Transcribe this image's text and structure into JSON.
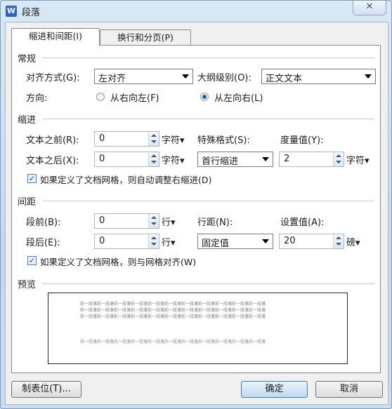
{
  "window": {
    "title": "段落",
    "close_symbol": "✕",
    "app_icon_letter": "W"
  },
  "tabs": [
    {
      "label": "缩进和间距(I)",
      "active": true
    },
    {
      "label": "换行和分页(P)",
      "active": false
    }
  ],
  "general": {
    "title": "常规",
    "alignment_label": "对齐方式(G):",
    "alignment_value": "左对齐",
    "outline_label": "大纲级别(O):",
    "outline_value": "正文文本",
    "direction_label": "方向:",
    "rtl_label": "从右向左(F)",
    "ltr_label": "从左向右(L)",
    "direction_selected": "ltr"
  },
  "indent": {
    "title": "缩进",
    "before_label": "文本之前(R):",
    "before_value": "0",
    "before_unit": "字符▾",
    "after_label": "文本之后(X):",
    "after_value": "0",
    "after_unit": "字符▾",
    "special_label": "特殊格式(S):",
    "special_value": "首行缩进",
    "measure_label": "度量值(Y):",
    "measure_value": "2",
    "measure_unit": "字符▾",
    "grid_check_label": "如果定义了文档网格，则自动调整右缩进(D)",
    "grid_checked": true
  },
  "spacing": {
    "title": "间距",
    "before_label": "段前(B):",
    "before_value": "0",
    "before_unit": "行▾",
    "after_label": "段后(E):",
    "after_value": "0",
    "after_unit": "行▾",
    "line_label": "行距(N):",
    "line_value": "固定值",
    "setting_label": "设置值(A):",
    "setting_value": "20",
    "setting_unit": "磅▾",
    "grid_check_label": "如果定义了文档网格，则与网格对齐(W)",
    "grid_checked": true
  },
  "preview": {
    "title": "预览",
    "prev_lines": [
      "前一段落前一段落前一段落前一段落前一段落前一段落前一段落前一段落前一段落前一段落前一段落",
      "前一段落前一段落前一段落前一段落前一段落前一段落前一段落前一段落前一段落前一段落前一段落",
      "前一段落前一段落前一段落前一段落前一段落前一段落前一段落前一段落前一段落前一段落前一段落"
    ],
    "next_line": "后一段落后一段落后一段落后一段落后一段落后一段落后一段落后一段落后一段落后一段落后一段落"
  },
  "buttons": {
    "tabs_button": "制表位(T)...",
    "ok": "确定",
    "cancel": "取消"
  },
  "colors": {
    "accent": "#1a5fb4",
    "title_bg": "#cfe0f2"
  }
}
